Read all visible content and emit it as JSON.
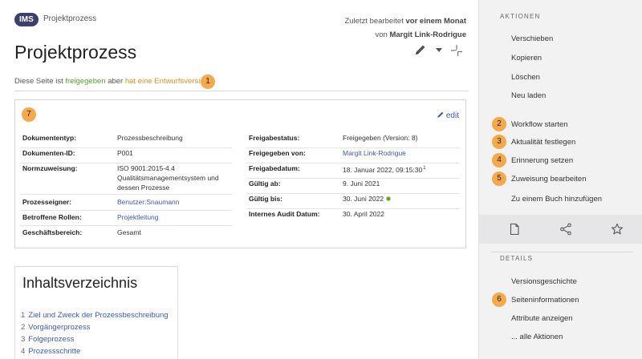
{
  "header": {
    "badge": "IMS",
    "breadcrumb": "Projektprozess",
    "edited_prefix": "Zuletzt bearbeitet",
    "edited_when": "vor einem Monat",
    "edited_by_prefix": "von",
    "edited_by": "Margit Link-Rodrigue"
  },
  "page": {
    "title": "Projektprozess"
  },
  "status": {
    "prefix": "Diese Seite ist",
    "released": "freigegeben",
    "middle": "aber",
    "draft": "hat eine Entwurfsversion",
    "marker": "1"
  },
  "infobox": {
    "marker": "7",
    "edit_label": "edit",
    "left": [
      {
        "label": "Dokumententyp:",
        "value": "Prozessbeschreibung"
      },
      {
        "label": "Dokumenten-ID:",
        "value": "P001"
      },
      {
        "label": "Normzuweisung:",
        "value_lines": [
          "ISO 9001:2015-4.4",
          "Qualitätsmanagementsystem und",
          "dessen Prozesse"
        ]
      },
      {
        "label": "Prozesseigner:",
        "value": "Benutzer:Snaumann"
      },
      {
        "label": "Betroffene Rollen:",
        "value": "Projektleitung"
      },
      {
        "label": "Geschäftsbereich:",
        "value": "Gesamt"
      }
    ],
    "right": [
      {
        "label": "Freigabestatus:",
        "value": "Freigegeben (Version: 8)"
      },
      {
        "label": "Freigegeben von:",
        "value": "Margit Link-Rodrigue"
      },
      {
        "label": "Freigabedatum:",
        "value": "18. Januar 2022, 09:15:30",
        "sup": "1"
      },
      {
        "label": "Gültig ab:",
        "value": "9. Juni 2021"
      },
      {
        "label": "Gültig bis:",
        "value": "30. Juni 2022"
      },
      {
        "label": "Internes Audit Datum:",
        "value": "30. April 2022"
      }
    ]
  },
  "toc": {
    "title": "Inhaltsverzeichnis",
    "items": [
      {
        "num": "1",
        "label": "Ziel und Zweck der Prozessbeschreibung"
      },
      {
        "num": "2",
        "label": "Vorgängerprozess"
      },
      {
        "num": "3",
        "label": "Folgeprozess"
      },
      {
        "num": "4",
        "label": "Prozessschritte"
      }
    ]
  },
  "sidebar": {
    "actions_heading": "AKTIONEN",
    "actions": [
      {
        "label": "Verschieben"
      },
      {
        "label": "Kopieren"
      },
      {
        "label": "Löschen"
      },
      {
        "label": "Neu laden"
      },
      {
        "label": "Workflow starten",
        "marker": "2"
      },
      {
        "label": "Aktualität festlegen",
        "marker": "3"
      },
      {
        "label": "Erinnerung setzen",
        "marker": "4"
      },
      {
        "label": "Zuweisung bearbeiten",
        "marker": "5"
      },
      {
        "label": "Zu einem Buch hinzufügen"
      }
    ],
    "iconbar": [
      "page-icon",
      "share-icon",
      "star-icon"
    ],
    "details_heading": "DETAILS",
    "details": [
      {
        "label": "Versionsgeschichte"
      },
      {
        "label": "Seiteninformationen",
        "marker": "6"
      },
      {
        "label": "Attribute anzeigen"
      },
      {
        "label": "... alle Aktionen"
      }
    ]
  },
  "colors": {
    "badge": "#3d3f6e",
    "link": "#3e5bb0",
    "released": "#5a9e31",
    "draft": "#e0902a",
    "marker": "#f6a94b",
    "sidebar_bg": "#f2f2f3"
  }
}
